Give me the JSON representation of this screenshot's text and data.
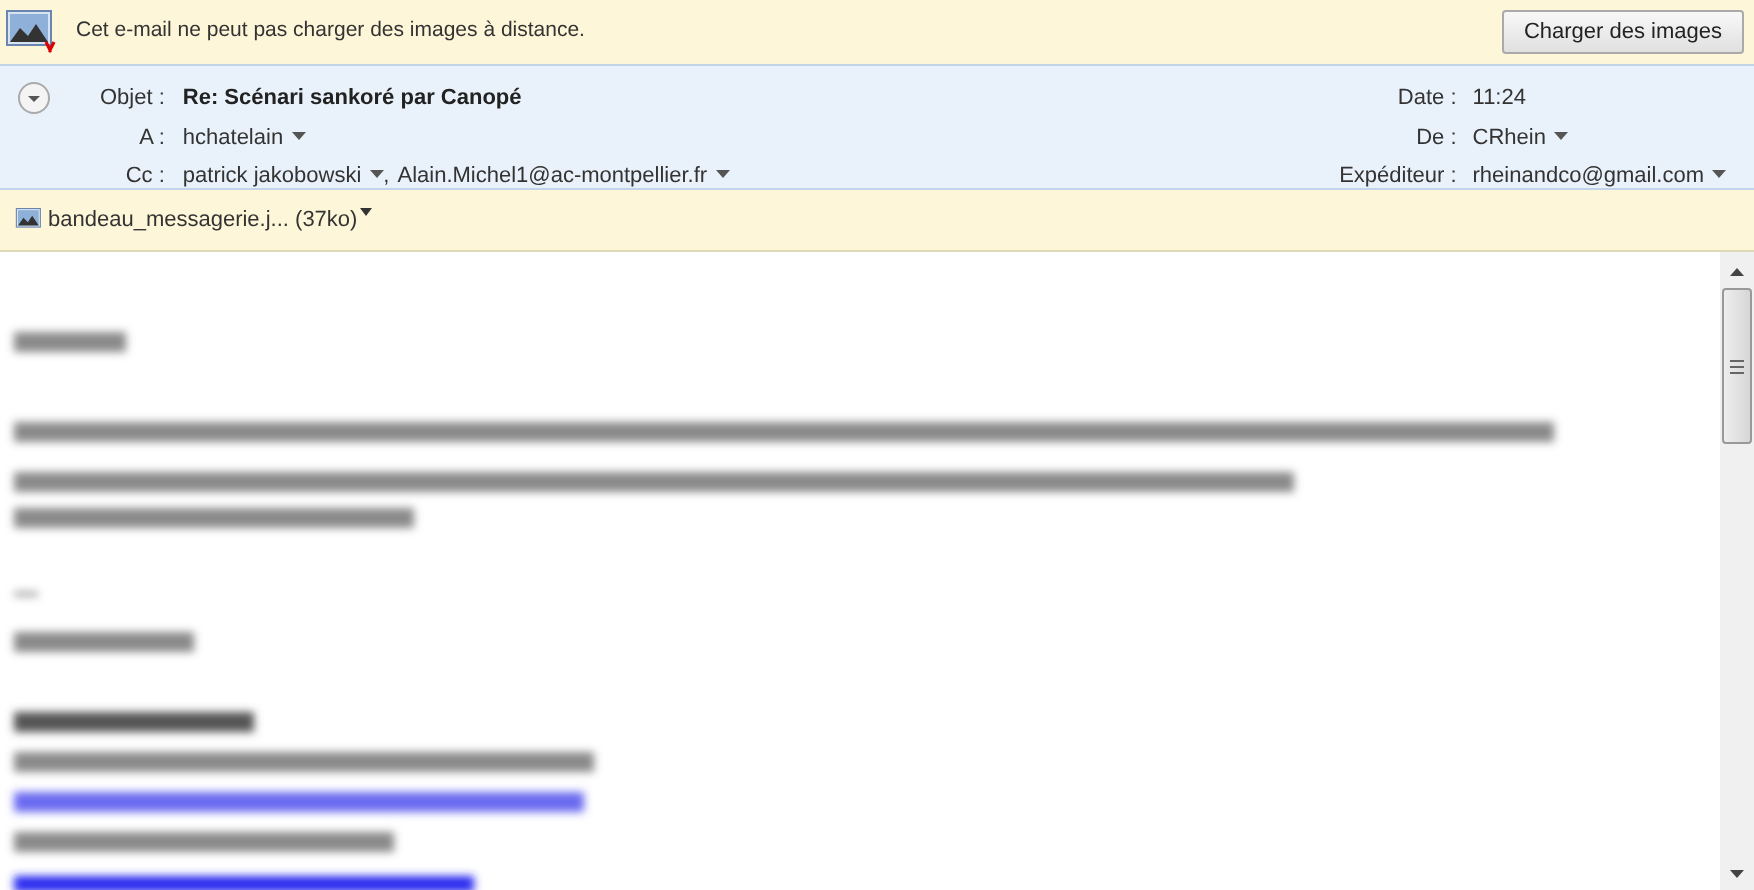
{
  "notice": {
    "text": "Cet e-mail ne peut pas charger des images à distance.",
    "button": "Charger des images"
  },
  "header": {
    "left": [
      {
        "label": "Objet :",
        "value": "Re: Scénari sankoré par Canopé",
        "kind": "subject"
      },
      {
        "label": "A :",
        "value": "hchatelain",
        "kind": "contacts"
      },
      {
        "label": "Cc :",
        "values": [
          "patrick jakobowski",
          "Alain.Michel1@ac-montpellier.fr"
        ],
        "separator": ",",
        "kind": "contacts"
      }
    ],
    "right": [
      {
        "label": "Date :",
        "value": "11:24",
        "kind": "plain"
      },
      {
        "label": "De :",
        "value": "CRhein",
        "kind": "contact"
      },
      {
        "label": "Expéditeur :",
        "value": "rheinandco@gmail.com",
        "kind": "contact"
      }
    ]
  },
  "attachment": {
    "name": "bandeau_messagerie.j...",
    "size": "(37ko)"
  }
}
